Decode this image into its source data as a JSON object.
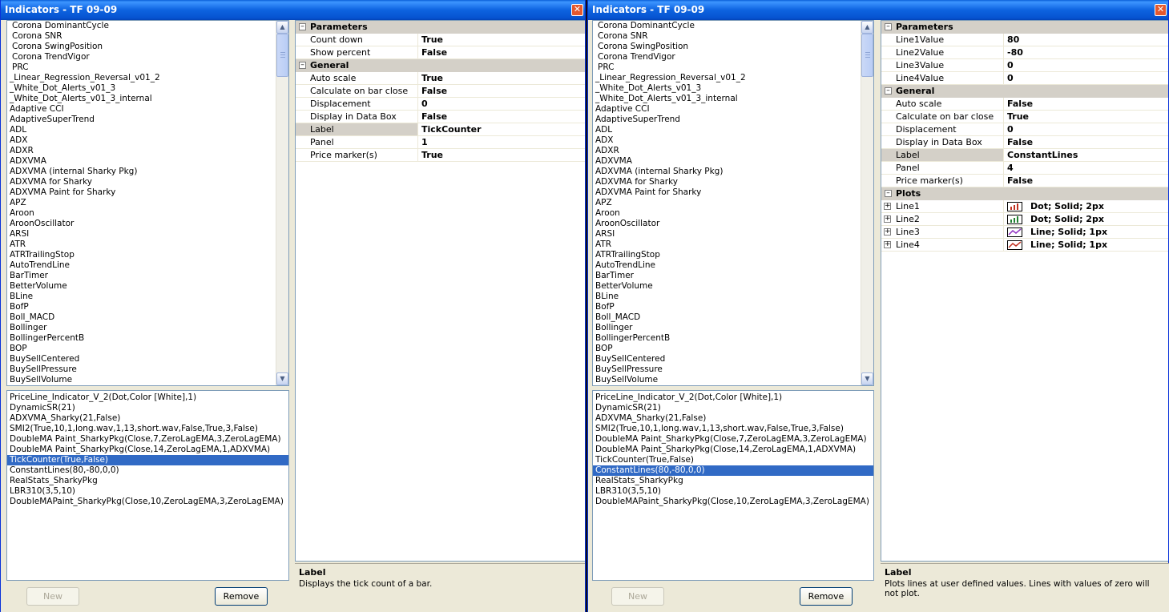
{
  "left": {
    "title": "Indicators - TF 09-09",
    "indicator_list": [
      "Corona DominantCycle",
      "Corona SNR",
      "Corona SwingPosition",
      "Corona TrendVigor",
      "PRC",
      "_Linear_Regression_Reversal_v01_2",
      "_White_Dot_Alerts_v01_3",
      "_White_Dot_Alerts_v01_3_internal",
      "Adaptive CCI",
      "AdaptiveSuperTrend",
      "ADL",
      "ADX",
      "ADXR",
      "ADXVMA",
      "ADXVMA (internal Sharky Pkg)",
      "ADXVMA for Sharky",
      "ADXVMA Paint for Sharky",
      "APZ",
      "Aroon",
      "AroonOscillator",
      "ARSI",
      "ATR",
      "ATRTrailingStop",
      "AutoTrendLine",
      "BarTimer",
      "BetterVolume",
      "BLine",
      "BofP",
      "Boll_MACD",
      "Bollinger",
      "BollingerPercentB",
      "BOP",
      "BuySellCentered",
      "BuySellPressure",
      "BuySellVolume"
    ],
    "applied": [
      "PriceLine_Indicator_V_2(Dot,Color [White],1)",
      "DynamicSR(21)",
      "ADXVMA_Sharky(21,False)",
      "SMI2(True,10,1,long.wav,1,13,short.wav,False,True,3,False)",
      "DoubleMA Paint_SharkyPkg(Close,7,ZeroLagEMA,3,ZeroLagEMA)",
      "DoubleMA Paint_SharkyPkg(Close,14,ZeroLagEMA,1,ADXVMA)",
      "TickCounter(True,False)",
      "ConstantLines(80,-80,0,0)",
      "RealStats_SharkyPkg",
      "LBR310(3,5,10)",
      "DoubleMAPaint_SharkyPkg(Close,10,ZeroLagEMA,3,ZeroLagEMA)"
    ],
    "new_label": "New",
    "remove_label": "Remove",
    "cat_parameters": "Parameters",
    "cat_general": "General",
    "parameters": [
      {
        "name": "Count down",
        "value": "True"
      },
      {
        "name": "Show percent",
        "value": "False"
      }
    ],
    "general": [
      {
        "name": "Auto scale",
        "value": "True"
      },
      {
        "name": "Calculate on bar close",
        "value": "False"
      },
      {
        "name": "Displacement",
        "value": "0"
      },
      {
        "name": "Display in Data Box",
        "value": "False"
      },
      {
        "name": "Label",
        "value": "TickCounter"
      },
      {
        "name": "Panel",
        "value": "1"
      },
      {
        "name": "Price marker(s)",
        "value": "True"
      }
    ],
    "desc_title": "Label",
    "desc_text": "Displays the tick count of a bar."
  },
  "right": {
    "title": "Indicators - TF 09-09",
    "indicator_list": [
      "Corona DominantCycle",
      "Corona SNR",
      "Corona SwingPosition",
      "Corona TrendVigor",
      "PRC",
      "_Linear_Regression_Reversal_v01_2",
      "_White_Dot_Alerts_v01_3",
      "_White_Dot_Alerts_v01_3_internal",
      "Adaptive CCI",
      "AdaptiveSuperTrend",
      "ADL",
      "ADX",
      "ADXR",
      "ADXVMA",
      "ADXVMA (internal Sharky Pkg)",
      "ADXVMA for Sharky",
      "ADXVMA Paint for Sharky",
      "APZ",
      "Aroon",
      "AroonOscillator",
      "ARSI",
      "ATR",
      "ATRTrailingStop",
      "AutoTrendLine",
      "BarTimer",
      "BetterVolume",
      "BLine",
      "BofP",
      "Boll_MACD",
      "Bollinger",
      "BollingerPercentB",
      "BOP",
      "BuySellCentered",
      "BuySellPressure",
      "BuySellVolume"
    ],
    "applied": [
      "PriceLine_Indicator_V_2(Dot,Color [White],1)",
      "DynamicSR(21)",
      "ADXVMA_Sharky(21,False)",
      "SMI2(True,10,1,long.wav,1,13,short.wav,False,True,3,False)",
      "DoubleMA Paint_SharkyPkg(Close,7,ZeroLagEMA,3,ZeroLagEMA)",
      "DoubleMA Paint_SharkyPkg(Close,14,ZeroLagEMA,1,ADXVMA)",
      "TickCounter(True,False)",
      "ConstantLines(80,-80,0,0)",
      "RealStats_SharkyPkg",
      "LBR310(3,5,10)",
      "DoubleMAPaint_SharkyPkg(Close,10,ZeroLagEMA,3,ZeroLagEMA)"
    ],
    "new_label": "New",
    "remove_label": "Remove",
    "cat_parameters": "Parameters",
    "cat_general": "General",
    "cat_plots": "Plots",
    "parameters": [
      {
        "name": "Line1Value",
        "value": "80"
      },
      {
        "name": "Line2Value",
        "value": "-80"
      },
      {
        "name": "Line3Value",
        "value": "0"
      },
      {
        "name": "Line4Value",
        "value": "0"
      }
    ],
    "general": [
      {
        "name": "Auto scale",
        "value": "False"
      },
      {
        "name": "Calculate on bar close",
        "value": "True"
      },
      {
        "name": "Displacement",
        "value": "0"
      },
      {
        "name": "Display in Data Box",
        "value": "False"
      },
      {
        "name": "Label",
        "value": "ConstantLines"
      },
      {
        "name": "Panel",
        "value": "4"
      },
      {
        "name": "Price marker(s)",
        "value": "False"
      }
    ],
    "plots": [
      {
        "name": "Line1",
        "value": "Dot; Solid; 2px"
      },
      {
        "name": "Line2",
        "value": "Dot; Solid; 2px"
      },
      {
        "name": "Line3",
        "value": "Line; Solid; 1px"
      },
      {
        "name": "Line4",
        "value": "Line; Solid; 1px"
      }
    ],
    "desc_title": "Label",
    "desc_text": "Plots lines at user defined values. Lines with values of zero will not plot."
  },
  "icons": {
    "close": "close-icon",
    "expand": "expand-icon",
    "collapse": "collapse-icon"
  },
  "colors": {
    "selection": "#316ac5",
    "titlebar": "#0a5fd8",
    "category": "#d4d0c8"
  }
}
